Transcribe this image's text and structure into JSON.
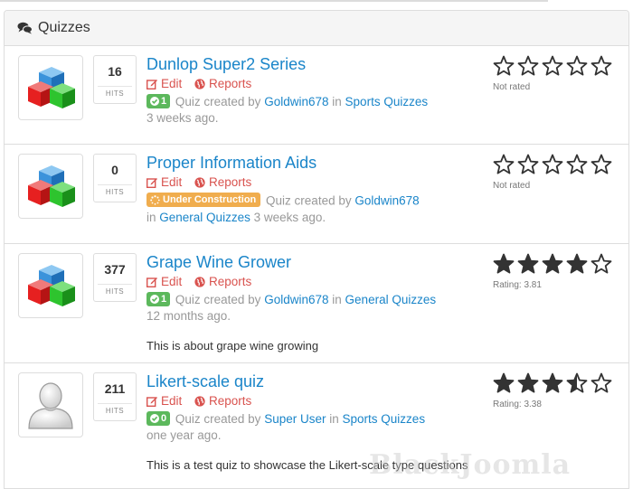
{
  "panel": {
    "title": "Quizzes",
    "icon": "comments-icon"
  },
  "hits_label": "HITS",
  "actions": {
    "edit": "Edit",
    "reports": "Reports"
  },
  "labels": {
    "created_by": "Quiz created by",
    "in": "in"
  },
  "quizzes": [
    {
      "title": "Dunlop Super2 Series",
      "hits": "16",
      "badge": "1",
      "author": "Goldwin678",
      "category": "Sports Quizzes",
      "time": "3 weeks ago.",
      "rating_text": "Not rated",
      "rating": 0
    },
    {
      "title": "Proper Information Aids",
      "hits": "0",
      "status": "Under Construction",
      "author": "Goldwin678",
      "category": "General Quizzes",
      "time": "3 weeks ago.",
      "rating_text": "Not rated",
      "rating": 0
    },
    {
      "title": "Grape Wine Grower",
      "hits": "377",
      "badge": "1",
      "author": "Goldwin678",
      "category": "General Quizzes",
      "time": "12 months ago.",
      "description": "This is about grape wine growing",
      "rating_text": "Rating: 3.81",
      "rating": 3.81
    },
    {
      "title": "Likert-scale quiz",
      "hits": "211",
      "badge": "0",
      "author": "Super User",
      "category": "Sports Quizzes",
      "time": "one year ago.",
      "description": "This is a test quiz to showcase the Likert-scale type questions",
      "rating_text": "Rating: 3.38",
      "rating": 3.38
    }
  ],
  "watermark": "BlackJoomla"
}
